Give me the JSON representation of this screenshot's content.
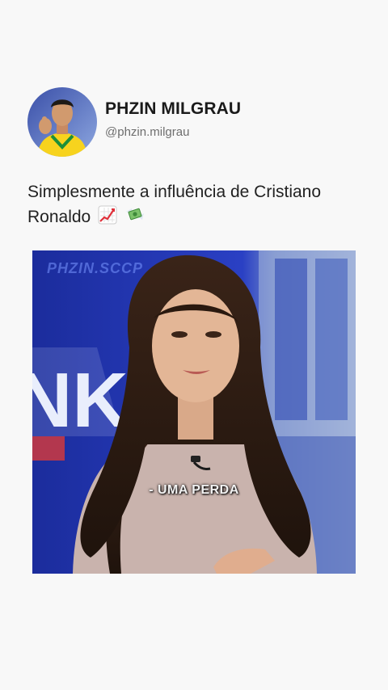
{
  "post": {
    "display_name": "PHZIN MILGRAU",
    "handle": "@phzin.milgrau",
    "avatar_icon": "profile-avatar",
    "caption": "Simplesmente a influência de Cristiano Ronaldo",
    "caption_emojis": [
      "chart-increasing-icon",
      "money-with-wings-icon"
    ]
  },
  "video": {
    "watermark": "PHZIN.SCCP",
    "subtitle": "- UMA PERDA",
    "colors": {
      "studio_blue": "#2338b8",
      "accent": "#e23a3a"
    }
  }
}
